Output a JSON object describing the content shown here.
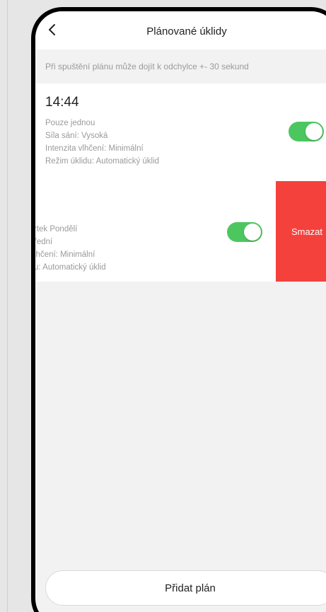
{
  "nav": {
    "back_icon": "chevron-left-icon",
    "title": "Plánované úklidy"
  },
  "notice": "Při spuštění plánu může dojít k odchylce +- 30 sekund",
  "schedules": [
    {
      "time": "14:44",
      "repeat": "Pouze jednou",
      "suction": "Síla sání: Vysoká",
      "mopping": "Intenzita vlhčení: Minimální",
      "mode": "Režim úklidu: Automatický úklid",
      "enabled": true
    },
    {
      "repeat": "rtek Pondělí",
      "suction": "řední",
      "mopping": "lhčení: Minimální",
      "mode": "u: Automatický úklid",
      "enabled": true,
      "delete_label": "Smazat"
    }
  ],
  "add_button": "Přidat plán",
  "colors": {
    "toggle_on": "#4cc760",
    "delete": "#f5413c"
  }
}
